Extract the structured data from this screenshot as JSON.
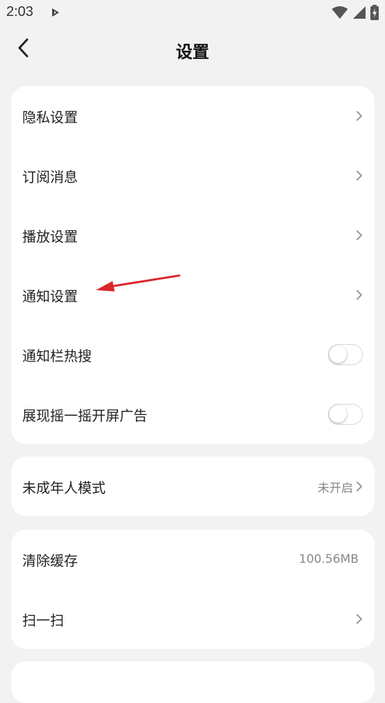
{
  "status_bar": {
    "time": "2:03",
    "icons": [
      "play-store-icon",
      "wifi-icon",
      "cell-signal-icon",
      "battery-charging-icon"
    ]
  },
  "header": {
    "title": "设置",
    "back_icon": "chevron-left-icon"
  },
  "group1": {
    "privacy": "隐私设置",
    "subscription": "订阅消息",
    "playback": "播放设置",
    "notification": "通知设置",
    "hot_search": "通知栏热搜",
    "hot_search_on": false,
    "shake_ad": "展现摇一摇开屏广告",
    "shake_ad_on": false
  },
  "group2": {
    "minor_mode": "未成年人模式",
    "minor_mode_status": "未开启"
  },
  "group3": {
    "clear_cache": "清除缓存",
    "cache_size": "100.56MB",
    "scan": "扫一扫"
  },
  "colors": {
    "background": "#f2f2f2",
    "card": "#ffffff",
    "annotation_arrow": "#d9262a"
  }
}
